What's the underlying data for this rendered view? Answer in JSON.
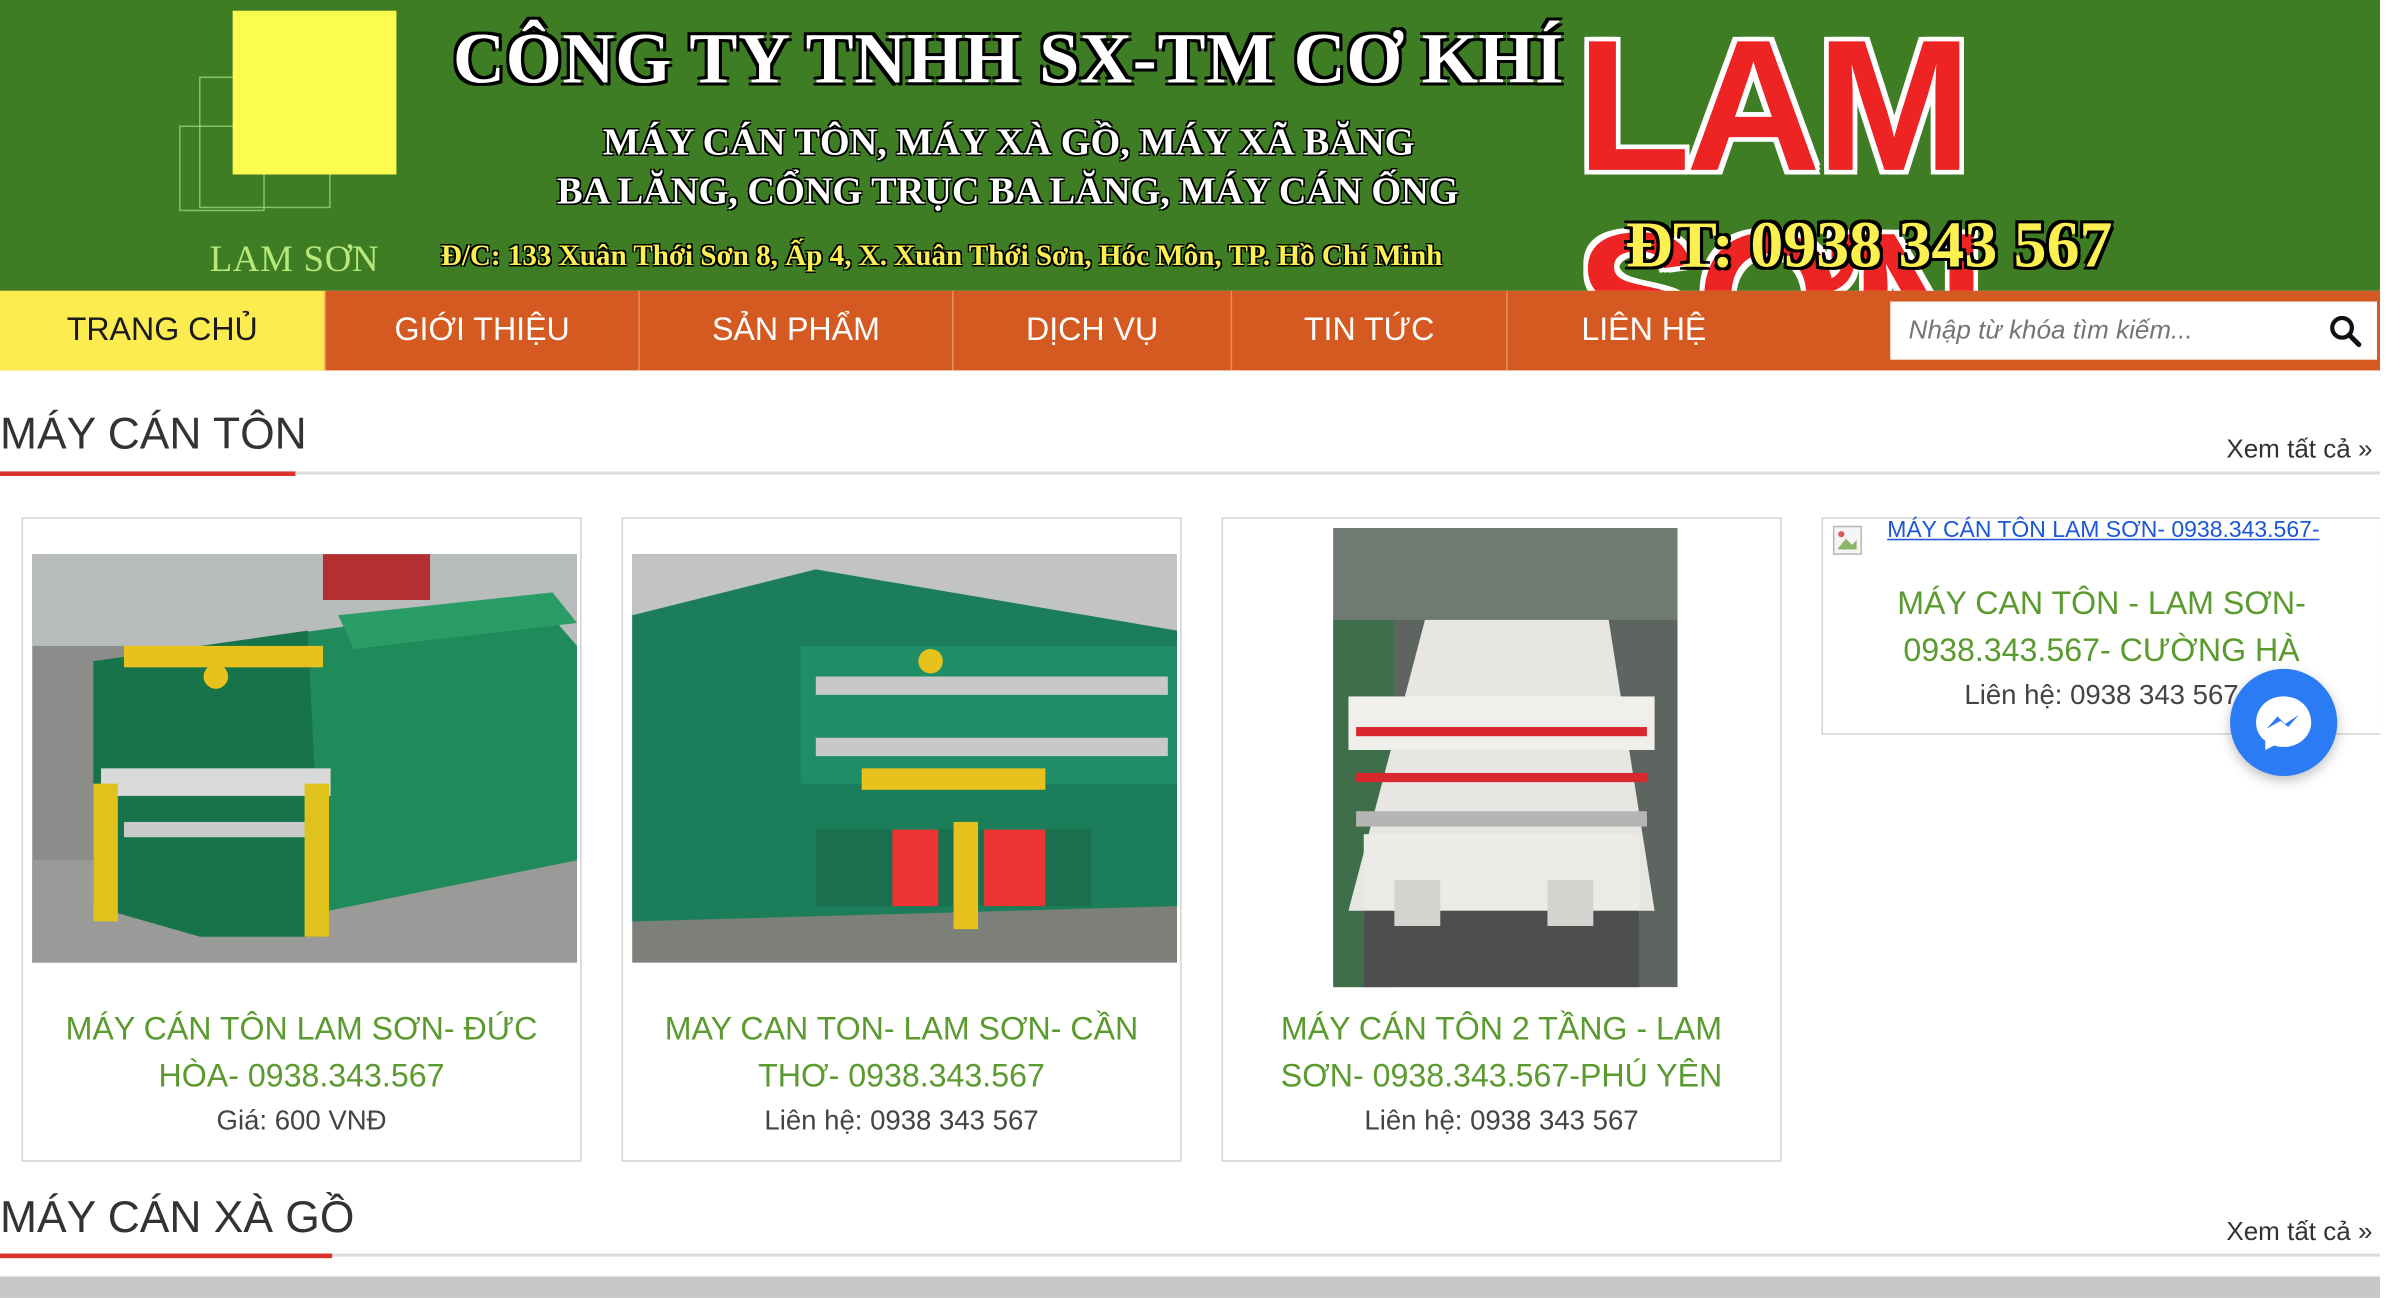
{
  "header": {
    "logo_text": "LAM SƠN",
    "company_name": "CÔNG TY TNHH SX-TM CƠ KHÍ",
    "services_line1": "MÁY CÁN TÔN, MÁY XÀ GỒ, MÁY XÃ BĂNG",
    "services_line2": "BA LĂNG, CỔNG TRỤC BA LĂNG, MÁY CÁN ỐNG",
    "address": "Đ/C: 133 Xuân Thới Sơn 8, Ấp 4, X. Xuân Thới Sơn, Hóc Môn, TP. Hồ Chí Minh",
    "brand": "LAM SƠN",
    "phone": "ĐT: 0938 343 567",
    "colors": {
      "banner": "#3f7d24",
      "logo_square": "#fcfc4e",
      "brand": "#ee2424",
      "phone": "#fcf050"
    }
  },
  "nav": {
    "items": [
      {
        "label": "TRANG CHỦ",
        "active": true
      },
      {
        "label": "GIỚI THIỆU",
        "active": false
      },
      {
        "label": "SẢN PHẨM",
        "active": false
      },
      {
        "label": "DỊCH VỤ",
        "active": false
      },
      {
        "label": "TIN TỨC",
        "active": false
      },
      {
        "label": "LIÊN HỆ",
        "active": false
      }
    ],
    "search_placeholder": "Nhập từ khóa tìm kiếm...",
    "colors": {
      "bar": "#d55a22",
      "active": "#fcec50"
    }
  },
  "sections": [
    {
      "title": "MÁY CÁN TÔN",
      "view_all": "Xem tất cả »",
      "products": [
        {
          "name": "MÁY CÁN TÔN LAM SƠN- ĐỨC HÒA- 0938.343.567",
          "price": "Giá: 600 VNĐ"
        },
        {
          "name": "MAY CAN TON- LAM SƠN- CẦN THƠ- 0938.343.567",
          "price": "Liên hệ: 0938 343 567"
        },
        {
          "name": "MÁY CÁN TÔN 2 TẦNG - LAM SƠN- 0938.343.567-PHÚ YÊN",
          "price": "Liên hệ: 0938 343 567"
        },
        {
          "name": "MÁY CAN TÔN - LAM SƠN- 0938.343.567- CƯỜNG HÀ",
          "price": "Liên hệ: 0938 343 567",
          "broken_image_alt": "MÁY CÁN TÔN LAM SƠN- 0938.343.567-"
        }
      ]
    },
    {
      "title": "MÁY CÁN XÀ GỒ",
      "view_all": "Xem tất cả »"
    }
  ],
  "icons": {
    "search": "search-icon",
    "messenger": "messenger-icon",
    "broken_image": "broken-image-icon"
  }
}
